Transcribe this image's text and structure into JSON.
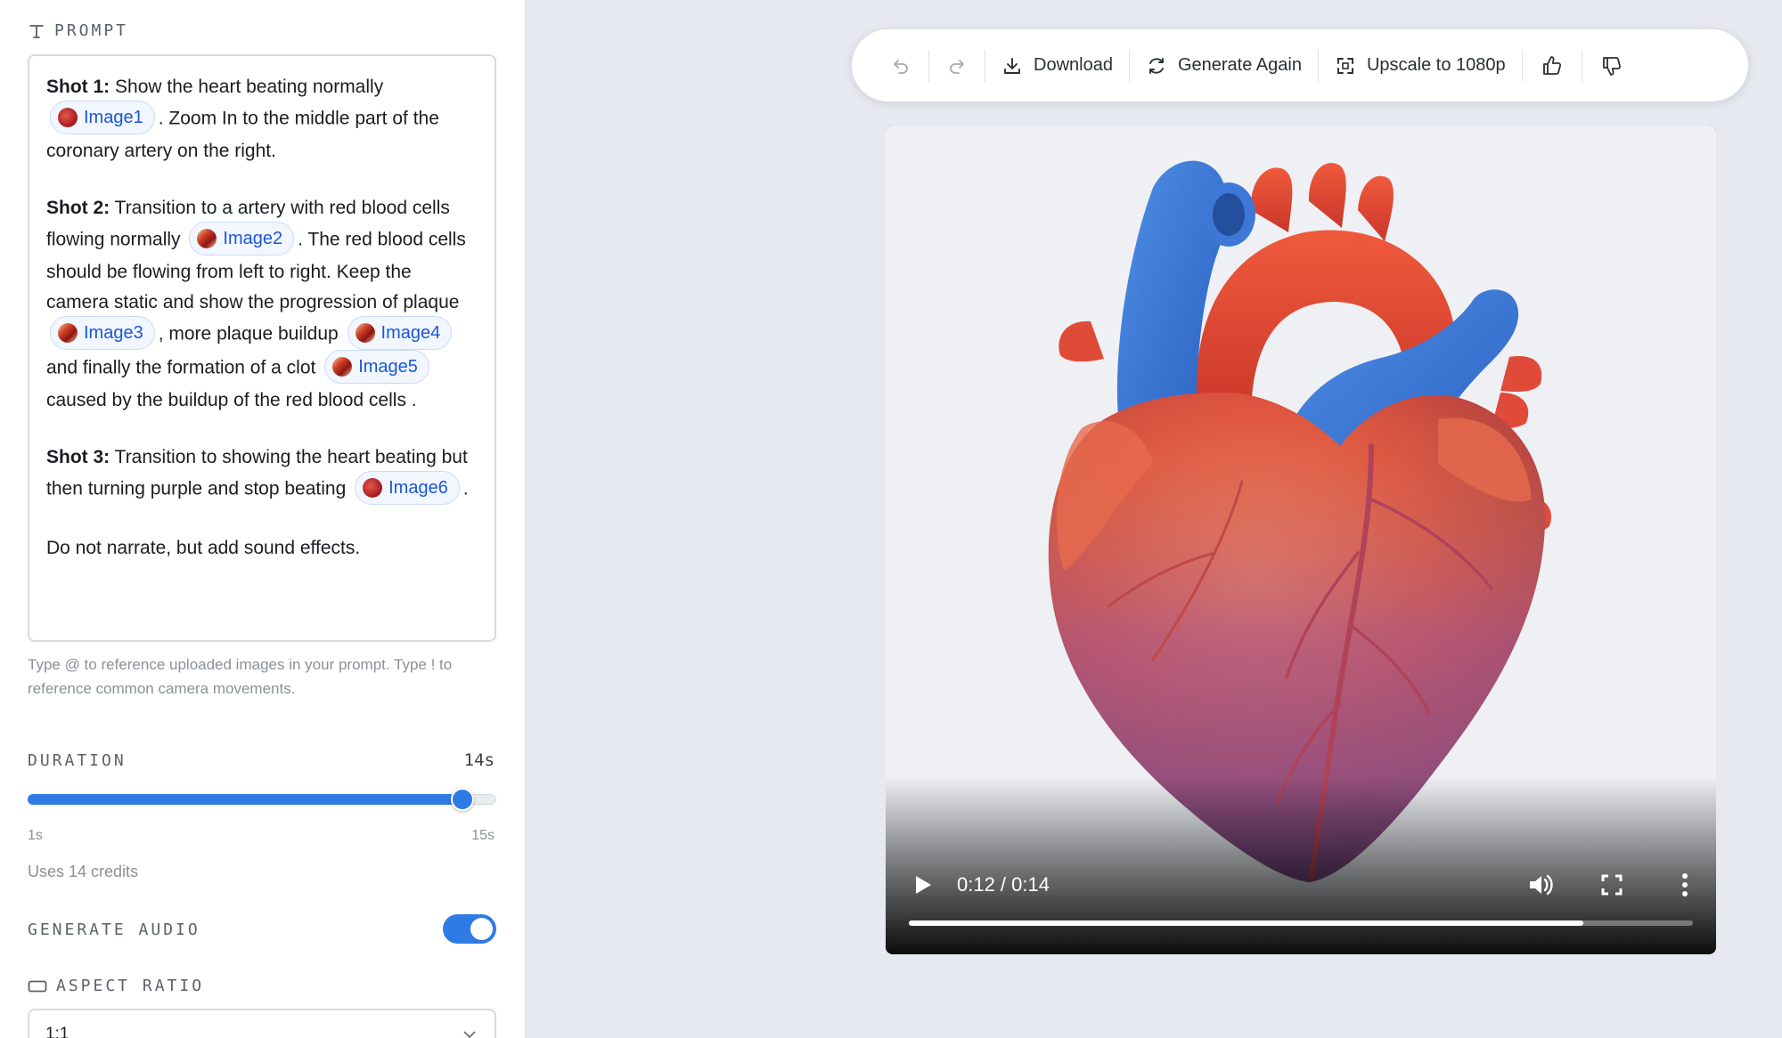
{
  "prompt": {
    "section_label": "PROMPT",
    "shot1": {
      "label": "Shot 1:",
      "text_a": "Show the heart beating normally",
      "image_ref": "Image1",
      "text_b": ". Zoom In to the middle part of the coronary artery on the right."
    },
    "shot2": {
      "label": "Shot 2:",
      "text_a": "Transition to a artery with red blood cells flowing normally",
      "ref_a": "Image2",
      "text_b": ". The red blood cells should be flowing from left to right. Keep the camera static and show the progression of plaque",
      "ref_b": "Image3",
      "text_c": ", more plaque buildup",
      "ref_c": "Image4",
      "text_d": "and finally the formation of a clot",
      "ref_d": "Image5",
      "text_e": "caused by the buildup of the red blood cells ."
    },
    "shot3": {
      "label": "Shot 3:",
      "text_a": "Transition to showing the heart beating but then turning purple and stop beating",
      "image_ref": "Image6",
      "text_b": "."
    },
    "closing": "Do not narrate, but add sound effects.",
    "hint": "Type @ to reference uploaded images in your prompt. Type ! to reference common camera movements."
  },
  "duration": {
    "label": "DURATION",
    "value_text": "14s",
    "value": 14,
    "min": 1,
    "max": 15,
    "min_label": "1s",
    "max_label": "15s",
    "credits": "Uses 14 credits"
  },
  "audio": {
    "label": "GENERATE AUDIO",
    "enabled": true
  },
  "aspect": {
    "label": "ASPECT RATIO",
    "value": "1:1"
  },
  "toolbar": {
    "download": "Download",
    "generate_again": "Generate Again",
    "upscale": "Upscale to 1080p"
  },
  "player": {
    "time": "0:12 / 0:14",
    "progress": 0.86
  },
  "colors": {
    "accent": "#2f7be5",
    "chip_text": "#1a56d6"
  }
}
